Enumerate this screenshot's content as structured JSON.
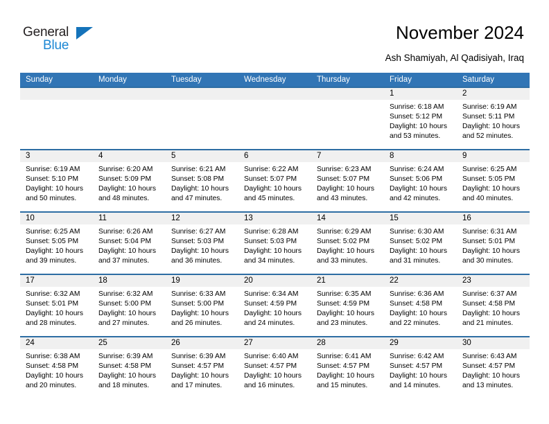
{
  "brand": {
    "name_part1": "General",
    "name_part2": "Blue",
    "accent_color": "#1c87d4",
    "triangle_color": "#1573ba"
  },
  "header": {
    "title": "November 2024",
    "subtitle": "Ash Shamiyah, Al Qadisiyah, Iraq"
  },
  "theme": {
    "header_blue": "#3175b5",
    "rule_blue": "#2d6da3",
    "daynum_band": "#f0f0f0"
  },
  "weekdays": [
    "Sunday",
    "Monday",
    "Tuesday",
    "Wednesday",
    "Thursday",
    "Friday",
    "Saturday"
  ],
  "weeks": [
    [
      {
        "day": "",
        "sunrise": "",
        "sunset": "",
        "daylight": "",
        "daylight2": ""
      },
      {
        "day": "",
        "sunrise": "",
        "sunset": "",
        "daylight": "",
        "daylight2": ""
      },
      {
        "day": "",
        "sunrise": "",
        "sunset": "",
        "daylight": "",
        "daylight2": ""
      },
      {
        "day": "",
        "sunrise": "",
        "sunset": "",
        "daylight": "",
        "daylight2": ""
      },
      {
        "day": "",
        "sunrise": "",
        "sunset": "",
        "daylight": "",
        "daylight2": ""
      },
      {
        "day": "1",
        "sunrise": "Sunrise: 6:18 AM",
        "sunset": "Sunset: 5:12 PM",
        "daylight": "Daylight: 10 hours",
        "daylight2": "and 53 minutes."
      },
      {
        "day": "2",
        "sunrise": "Sunrise: 6:19 AM",
        "sunset": "Sunset: 5:11 PM",
        "daylight": "Daylight: 10 hours",
        "daylight2": "and 52 minutes."
      }
    ],
    [
      {
        "day": "3",
        "sunrise": "Sunrise: 6:19 AM",
        "sunset": "Sunset: 5:10 PM",
        "daylight": "Daylight: 10 hours",
        "daylight2": "and 50 minutes."
      },
      {
        "day": "4",
        "sunrise": "Sunrise: 6:20 AM",
        "sunset": "Sunset: 5:09 PM",
        "daylight": "Daylight: 10 hours",
        "daylight2": "and 48 minutes."
      },
      {
        "day": "5",
        "sunrise": "Sunrise: 6:21 AM",
        "sunset": "Sunset: 5:08 PM",
        "daylight": "Daylight: 10 hours",
        "daylight2": "and 47 minutes."
      },
      {
        "day": "6",
        "sunrise": "Sunrise: 6:22 AM",
        "sunset": "Sunset: 5:07 PM",
        "daylight": "Daylight: 10 hours",
        "daylight2": "and 45 minutes."
      },
      {
        "day": "7",
        "sunrise": "Sunrise: 6:23 AM",
        "sunset": "Sunset: 5:07 PM",
        "daylight": "Daylight: 10 hours",
        "daylight2": "and 43 minutes."
      },
      {
        "day": "8",
        "sunrise": "Sunrise: 6:24 AM",
        "sunset": "Sunset: 5:06 PM",
        "daylight": "Daylight: 10 hours",
        "daylight2": "and 42 minutes."
      },
      {
        "day": "9",
        "sunrise": "Sunrise: 6:25 AM",
        "sunset": "Sunset: 5:05 PM",
        "daylight": "Daylight: 10 hours",
        "daylight2": "and 40 minutes."
      }
    ],
    [
      {
        "day": "10",
        "sunrise": "Sunrise: 6:25 AM",
        "sunset": "Sunset: 5:05 PM",
        "daylight": "Daylight: 10 hours",
        "daylight2": "and 39 minutes."
      },
      {
        "day": "11",
        "sunrise": "Sunrise: 6:26 AM",
        "sunset": "Sunset: 5:04 PM",
        "daylight": "Daylight: 10 hours",
        "daylight2": "and 37 minutes."
      },
      {
        "day": "12",
        "sunrise": "Sunrise: 6:27 AM",
        "sunset": "Sunset: 5:03 PM",
        "daylight": "Daylight: 10 hours",
        "daylight2": "and 36 minutes."
      },
      {
        "day": "13",
        "sunrise": "Sunrise: 6:28 AM",
        "sunset": "Sunset: 5:03 PM",
        "daylight": "Daylight: 10 hours",
        "daylight2": "and 34 minutes."
      },
      {
        "day": "14",
        "sunrise": "Sunrise: 6:29 AM",
        "sunset": "Sunset: 5:02 PM",
        "daylight": "Daylight: 10 hours",
        "daylight2": "and 33 minutes."
      },
      {
        "day": "15",
        "sunrise": "Sunrise: 6:30 AM",
        "sunset": "Sunset: 5:02 PM",
        "daylight": "Daylight: 10 hours",
        "daylight2": "and 31 minutes."
      },
      {
        "day": "16",
        "sunrise": "Sunrise: 6:31 AM",
        "sunset": "Sunset: 5:01 PM",
        "daylight": "Daylight: 10 hours",
        "daylight2": "and 30 minutes."
      }
    ],
    [
      {
        "day": "17",
        "sunrise": "Sunrise: 6:32 AM",
        "sunset": "Sunset: 5:01 PM",
        "daylight": "Daylight: 10 hours",
        "daylight2": "and 28 minutes."
      },
      {
        "day": "18",
        "sunrise": "Sunrise: 6:32 AM",
        "sunset": "Sunset: 5:00 PM",
        "daylight": "Daylight: 10 hours",
        "daylight2": "and 27 minutes."
      },
      {
        "day": "19",
        "sunrise": "Sunrise: 6:33 AM",
        "sunset": "Sunset: 5:00 PM",
        "daylight": "Daylight: 10 hours",
        "daylight2": "and 26 minutes."
      },
      {
        "day": "20",
        "sunrise": "Sunrise: 6:34 AM",
        "sunset": "Sunset: 4:59 PM",
        "daylight": "Daylight: 10 hours",
        "daylight2": "and 24 minutes."
      },
      {
        "day": "21",
        "sunrise": "Sunrise: 6:35 AM",
        "sunset": "Sunset: 4:59 PM",
        "daylight": "Daylight: 10 hours",
        "daylight2": "and 23 minutes."
      },
      {
        "day": "22",
        "sunrise": "Sunrise: 6:36 AM",
        "sunset": "Sunset: 4:58 PM",
        "daylight": "Daylight: 10 hours",
        "daylight2": "and 22 minutes."
      },
      {
        "day": "23",
        "sunrise": "Sunrise: 6:37 AM",
        "sunset": "Sunset: 4:58 PM",
        "daylight": "Daylight: 10 hours",
        "daylight2": "and 21 minutes."
      }
    ],
    [
      {
        "day": "24",
        "sunrise": "Sunrise: 6:38 AM",
        "sunset": "Sunset: 4:58 PM",
        "daylight": "Daylight: 10 hours",
        "daylight2": "and 20 minutes."
      },
      {
        "day": "25",
        "sunrise": "Sunrise: 6:39 AM",
        "sunset": "Sunset: 4:58 PM",
        "daylight": "Daylight: 10 hours",
        "daylight2": "and 18 minutes."
      },
      {
        "day": "26",
        "sunrise": "Sunrise: 6:39 AM",
        "sunset": "Sunset: 4:57 PM",
        "daylight": "Daylight: 10 hours",
        "daylight2": "and 17 minutes."
      },
      {
        "day": "27",
        "sunrise": "Sunrise: 6:40 AM",
        "sunset": "Sunset: 4:57 PM",
        "daylight": "Daylight: 10 hours",
        "daylight2": "and 16 minutes."
      },
      {
        "day": "28",
        "sunrise": "Sunrise: 6:41 AM",
        "sunset": "Sunset: 4:57 PM",
        "daylight": "Daylight: 10 hours",
        "daylight2": "and 15 minutes."
      },
      {
        "day": "29",
        "sunrise": "Sunrise: 6:42 AM",
        "sunset": "Sunset: 4:57 PM",
        "daylight": "Daylight: 10 hours",
        "daylight2": "and 14 minutes."
      },
      {
        "day": "30",
        "sunrise": "Sunrise: 6:43 AM",
        "sunset": "Sunset: 4:57 PM",
        "daylight": "Daylight: 10 hours",
        "daylight2": "and 13 minutes."
      }
    ]
  ]
}
